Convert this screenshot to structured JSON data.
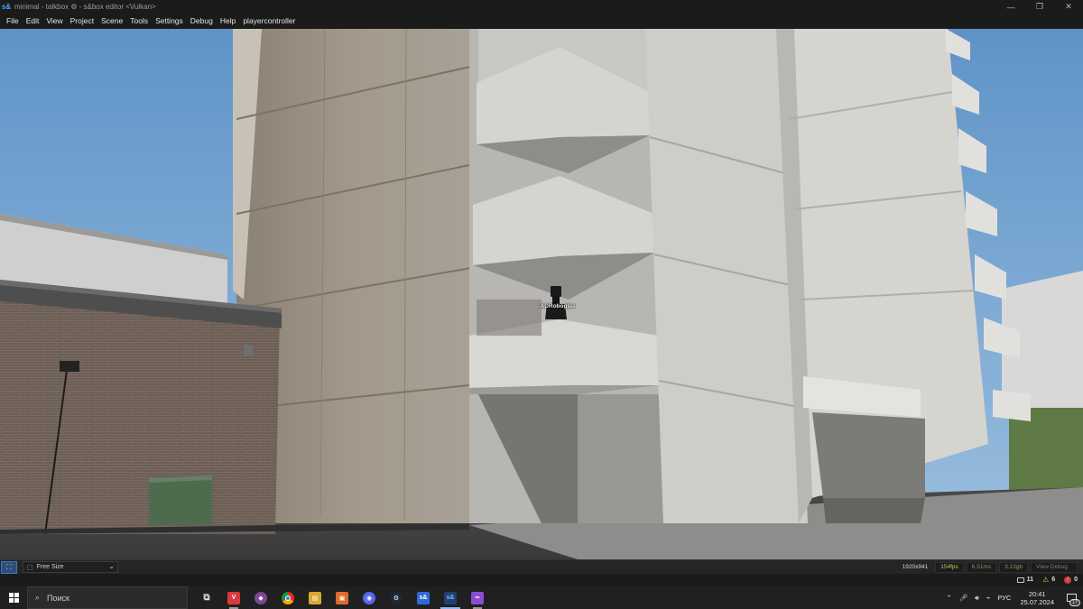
{
  "titlebar": {
    "logo": "s&",
    "title": "minimal - talkbox ⚙ - s&box editor <Vulkan>",
    "minimize": "—",
    "restore": "❐",
    "close": "✕"
  },
  "menu": {
    "items": [
      "File",
      "Edit",
      "View",
      "Project",
      "Scene",
      "Tools",
      "Settings",
      "Debug",
      "Help",
      "playercontroller"
    ]
  },
  "viewport": {
    "player_name": "ADRoboglas"
  },
  "viewport_toolbar": {
    "expand_icon": "expand-icon",
    "size_mode": "Free Size",
    "resolution": "1920x941",
    "fps": "154fps",
    "frame_ms": "6.51ms",
    "memory": "3.13gb",
    "debug_view": "View Debug"
  },
  "statusbar": {
    "messages_count": "11",
    "warnings_count": "6",
    "errors_count": "0"
  },
  "taskbar": {
    "search_placeholder": "Поиск",
    "language": "РУС",
    "time": "20:41",
    "date": "25.07.2024",
    "notifications": "17",
    "apps": [
      {
        "name": "task-view",
        "glyph": "⧉",
        "color": "#202020"
      },
      {
        "name": "vivaldi",
        "glyph": "V",
        "color": "#d83a3a"
      },
      {
        "name": "tor",
        "glyph": "◆",
        "color": "#7d4698"
      },
      {
        "name": "chrome",
        "glyph": "●",
        "color": "#3a8f3a"
      },
      {
        "name": "file-explorer",
        "glyph": "▤",
        "color": "#d9a830"
      },
      {
        "name": "app-orange",
        "glyph": "▣",
        "color": "#e06b2b"
      },
      {
        "name": "discord-badge",
        "glyph": "◉",
        "color": "#5865f2"
      },
      {
        "name": "steam",
        "glyph": "⚙",
        "color": "#1b2838"
      },
      {
        "name": "sbox",
        "glyph": "s&",
        "color": "#2d6ad8"
      },
      {
        "name": "sbox-editor",
        "glyph": "s&",
        "color": "#1f3f6f"
      },
      {
        "name": "visual-studio",
        "glyph": "∞",
        "color": "#8c4bd4"
      }
    ]
  }
}
